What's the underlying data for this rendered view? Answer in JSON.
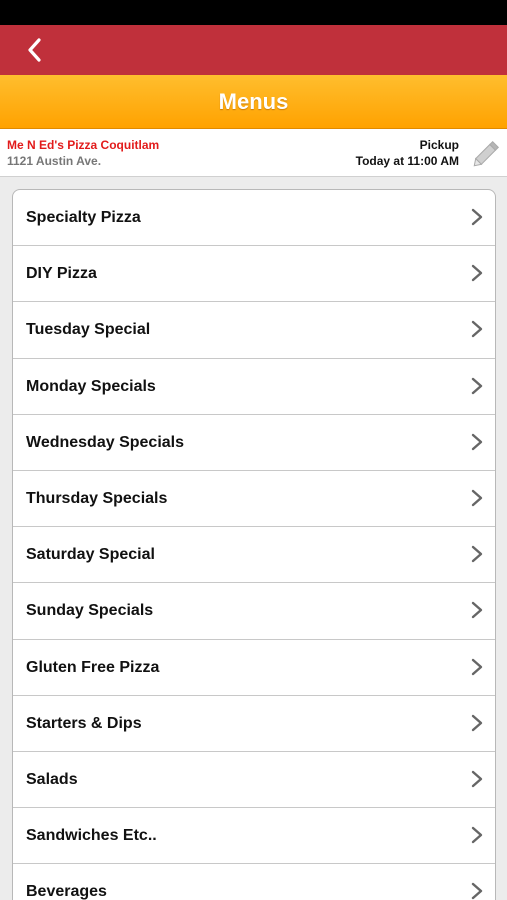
{
  "nav": {
    "back_icon": "chevron-left-icon",
    "bar_color": "#c0303b"
  },
  "header": {
    "title": "Menus",
    "accent": "#ffa200"
  },
  "store": {
    "name": "Me N Ed's Pizza Coquitlam",
    "address": "1121 Austin Ave.",
    "order_type": "Pickup",
    "order_time": "Today at 11:00 AM",
    "edit_icon": "pencil-icon"
  },
  "menu": {
    "items": [
      {
        "label": "Specialty Pizza"
      },
      {
        "label": "DIY Pizza"
      },
      {
        "label": "Tuesday Special"
      },
      {
        "label": "Monday Specials"
      },
      {
        "label": "Wednesday Specials"
      },
      {
        "label": "Thursday Specials"
      },
      {
        "label": "Saturday Special"
      },
      {
        "label": "Sunday Specials"
      },
      {
        "label": "Gluten Free Pizza"
      },
      {
        "label": "Starters & Dips"
      },
      {
        "label": "Salads"
      },
      {
        "label": "Sandwiches Etc.."
      },
      {
        "label": "Beverages"
      }
    ],
    "item_icon": "chevron-right-icon"
  }
}
